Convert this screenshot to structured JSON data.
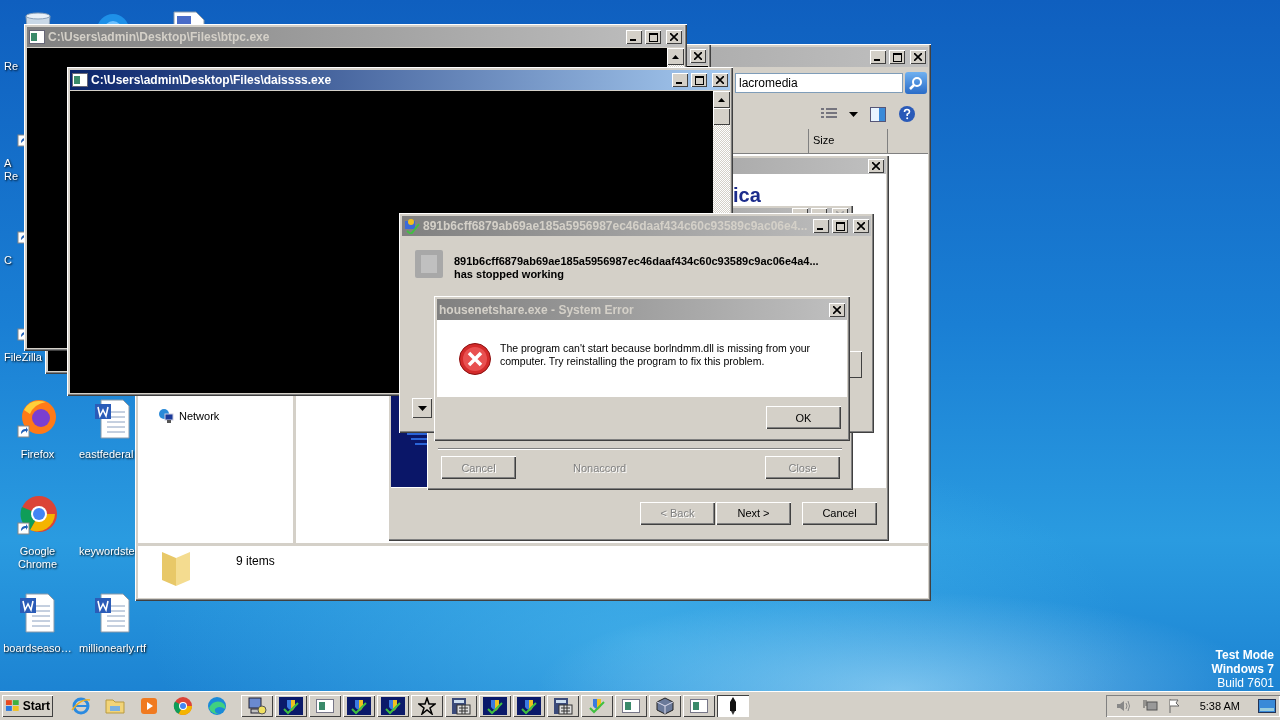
{
  "desktop": {
    "columns": [
      [
        {
          "kind": "recycle-bin",
          "label": [
            "Re"
          ],
          "clipped": true
        },
        {
          "kind": "acrobat",
          "label": [
            "A",
            "Re"
          ],
          "clipped": true
        },
        {
          "kind": "shortcut",
          "label": [
            "C"
          ],
          "clipped": true
        },
        {
          "kind": "filezilla",
          "label": [
            "FileZilla"
          ],
          "clipped": true
        },
        {
          "kind": "firefox",
          "label": [
            "Firefox"
          ],
          "clipped": false
        },
        {
          "kind": "chrome",
          "label": [
            "Google",
            "Chrome"
          ],
          "clipped": false
        },
        {
          "kind": "word",
          "label": [
            "boardseaso…"
          ],
          "clipped": false
        }
      ],
      [
        {
          "kind": "circle-app"
        },
        null,
        null,
        null,
        {
          "kind": "word",
          "label": [
            "eastfederal"
          ],
          "clipped": true
        },
        {
          "kind": "blank",
          "label": [
            "keywordste"
          ],
          "clipped": true
        },
        {
          "kind": "word",
          "label": [
            "millionearly.rtf"
          ]
        }
      ],
      [
        {
          "kind": "scan-doc"
        }
      ]
    ]
  },
  "explorer": {
    "active": false,
    "search": {
      "value": "lacromedia"
    },
    "columns": [
      {
        "label": "Size"
      }
    ],
    "nav_items": [
      {
        "label": "Network"
      }
    ],
    "status": "9 items"
  },
  "installer": {
    "heading": "ica",
    "buttons": [
      {
        "label": "< Back",
        "disabled": true
      },
      {
        "label": "Next >",
        "disabled": false
      },
      {
        "label": "Cancel",
        "disabled": false
      }
    ]
  },
  "license_dialog": {
    "items": [
      {
        "kind": "button",
        "label": "Cancel",
        "disabled": true
      },
      {
        "kind": "label",
        "label": "Nonaccord",
        "disabled": true
      },
      {
        "kind": "button",
        "label": "Close",
        "disabled": true
      }
    ]
  },
  "consoles": [
    {
      "title": "C:\\Users\\admin\\Desktop\\Files\\btpc.exe",
      "active": false
    },
    {
      "title": "C:\\Users\\admin\\Desktop\\Files\\daissss.exe",
      "active": true
    }
  ],
  "crash_dialog": {
    "title": "891b6cff6879ab69ae185a5956987ec46daaf434c60c93589c9ac06e4...",
    "active": false,
    "message": "891b6cff6879ab69ae185a5956987ec46daaf434c60c93589c9ac06e4a4...",
    "status": "has stopped working"
  },
  "error_dialog": {
    "title": "housenetshare.exe - System Error",
    "active": false,
    "message": "The program can't start because borlndmm.dll is missing from your computer. Try reinstalling the program to fix this problem.",
    "button": "OK"
  },
  "os_notice": [
    "Test Mode",
    "Windows 7",
    "Build 7601"
  ],
  "taskbar": {
    "start": "Start",
    "quick_launch": [
      {
        "kind": "ie"
      },
      {
        "kind": "folder"
      },
      {
        "kind": "media"
      },
      {
        "kind": "chrome"
      },
      {
        "kind": "edge"
      }
    ],
    "tasks": [
      {
        "kind": "installer",
        "selected": false
      },
      {
        "kind": "shield",
        "selected": false
      },
      {
        "kind": "console",
        "selected": false
      },
      {
        "kind": "shield",
        "selected": false
      },
      {
        "kind": "shield",
        "selected": false
      },
      {
        "kind": "star",
        "selected": false
      },
      {
        "kind": "calc",
        "selected": false
      },
      {
        "kind": "shield",
        "selected": false
      },
      {
        "kind": "shield",
        "selected": false
      },
      {
        "kind": "calc",
        "selected": false
      },
      {
        "kind": "shield-light",
        "selected": false
      },
      {
        "kind": "console",
        "selected": false
      },
      {
        "kind": "box",
        "selected": false
      },
      {
        "kind": "console",
        "selected": false
      },
      {
        "kind": "pen",
        "selected": true
      }
    ],
    "clock": "5:38 AM"
  }
}
